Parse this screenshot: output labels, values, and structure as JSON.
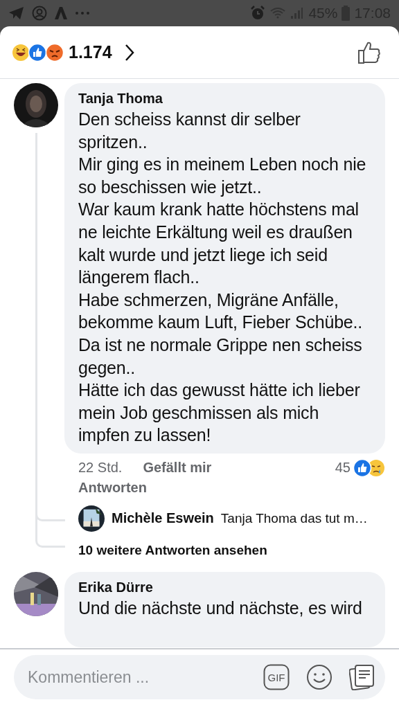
{
  "status_bar": {
    "battery": "45%",
    "time": "17:08"
  },
  "reactions": {
    "count": "1.174"
  },
  "comments": [
    {
      "author": "Tanja Thoma",
      "paragraphs": [
        "Den scheiss kannst dir selber spritzen..",
        "Mir ging es in meinem Leben noch nie so beschissen wie jetzt..",
        "War kaum krank hatte höchstens mal ne leichte Erkältung weil es draußen kalt wurde und jetzt liege ich seid längerem flach..",
        "Habe schmerzen, Migräne Anfälle, bekomme kaum Luft, Fieber Schübe..",
        "Da ist ne normale Grippe nen scheiss gegen..",
        "Hätte ich das gewusst hätte ich lieber mein Job geschmissen als mich impfen zu lassen!"
      ],
      "time": "22 Std.",
      "like": "Gefällt mir",
      "reply": "Antworten",
      "reaction_count": "45",
      "replies": [
        {
          "author": "Michèle Eswein",
          "text": "Tanja Thoma das tut m…"
        }
      ],
      "more_replies": "10 weitere Antworten ansehen"
    },
    {
      "author": "Erika Dürre",
      "paragraphs": [
        "Und die nächste und nächste, es wird"
      ]
    }
  ],
  "composer": {
    "placeholder": "Kommentieren ...",
    "gif": "GIF"
  }
}
